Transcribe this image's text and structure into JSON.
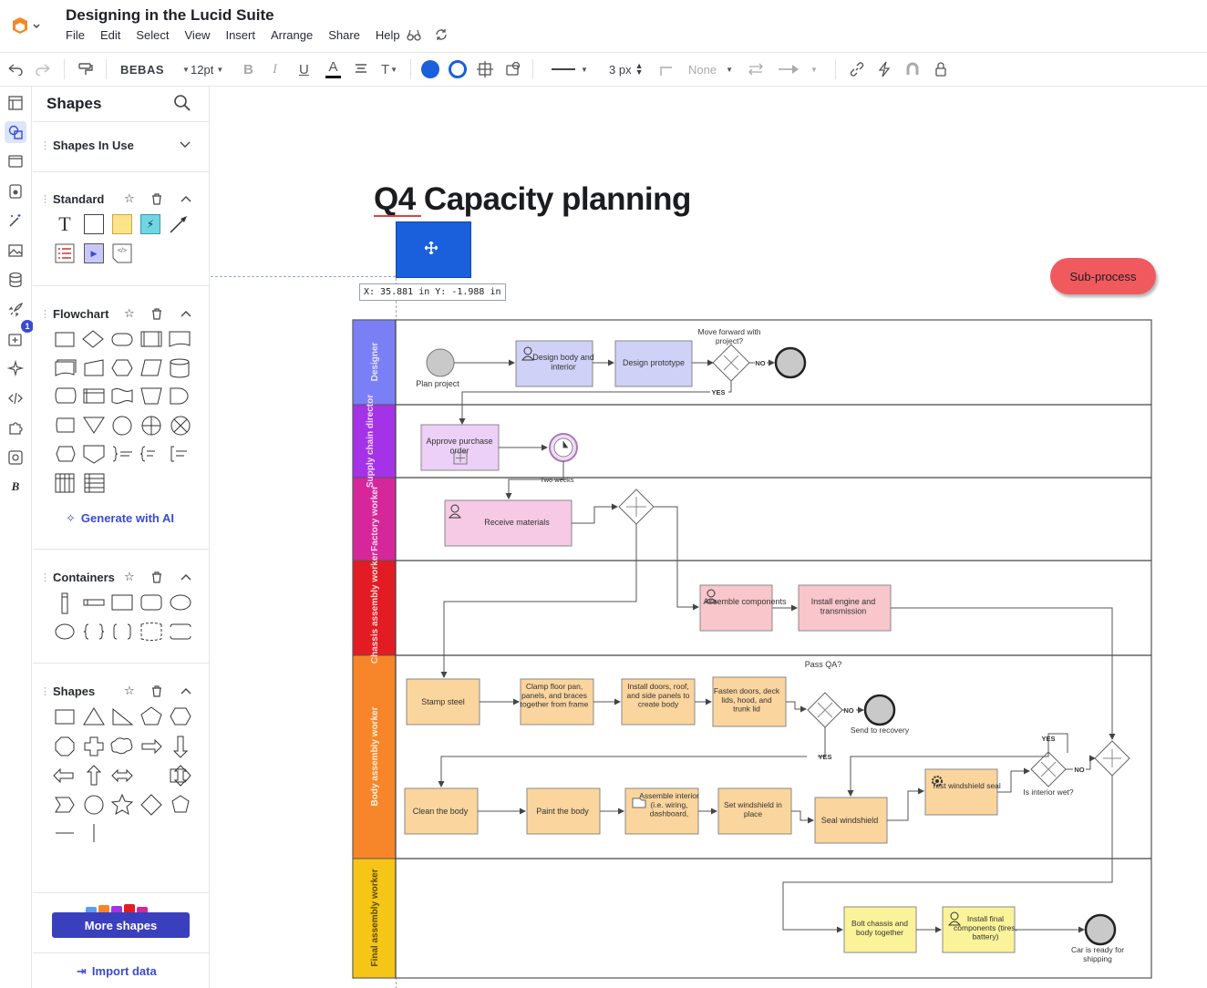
{
  "app": {
    "doc_title": "Designing in the Lucid Suite"
  },
  "menu": [
    "File",
    "Edit",
    "Select",
    "View",
    "Insert",
    "Arrange",
    "Share",
    "Help"
  ],
  "toolbar": {
    "font": "BEBAS",
    "font_size": "12pt",
    "line_width": "3 px",
    "arrow_none": "None"
  },
  "panel": {
    "title": "Shapes",
    "shapes_in_use": "Shapes In Use",
    "standard": "Standard",
    "flowchart": "Flowchart",
    "generate_ai": "Generate with AI",
    "containers": "Containers",
    "shapes": "Shapes",
    "more_shapes": "More shapes",
    "import_data": "Import data",
    "notification_count": "1"
  },
  "canvas": {
    "title": "Q4 Capacity planning",
    "coord_readout": "X: 35.881 in  Y: -1.988 in",
    "subprocess": "Sub-process"
  },
  "lanes": [
    {
      "label": "Designer",
      "color": "#7b7ff6"
    },
    {
      "label": "Supply chain director",
      "color": "#a433e8"
    },
    {
      "label": "Factory worker",
      "color": "#d6279a"
    },
    {
      "label": "Chassis assembly worker",
      "color": "#e31b23"
    },
    {
      "label": "Body assembly worker",
      "color": "#f7862b"
    },
    {
      "label": "Final assembly worker",
      "color": "#f5c518"
    }
  ],
  "nodes": {
    "plan_project": "Plan project",
    "design_body": "Design body and interior",
    "design_prototype": "Design prototype",
    "move_forward": "Move forward with project?",
    "no": "NO",
    "yes": "YES",
    "approve_po": "Approve purchase order",
    "two_weeks": "Two weeks",
    "receive_materials": "Receive materials",
    "assemble_components": "Assemble components",
    "install_engine": "Install engine and transmission",
    "pass_qa": "Pass QA?",
    "stamp_steel": "Stamp steel",
    "clamp_floor": "Clamp floor pan, panels, and braces together from frame",
    "install_doors": "Install doors, roof, and side panels to create body",
    "fasten_doors": "Fasten doors, deck lids, hood, and trunk lid",
    "send_recovery": "Send to recovery",
    "clean_body": "Clean the body",
    "paint_body": "Paint the body",
    "assemble_interior": "Assemble interior (i.e. wiring, dashboard,",
    "set_windshield": "Set windshield in place",
    "seal_windshield": "Seal windshield",
    "test_seal": "Test windshield seal",
    "interior_wet": "Is interior wet?",
    "bolt_chassis": "Bolt chassis and body together",
    "install_final": "Install final components (tires, battery)",
    "car_ready": "Car is ready for shipping"
  },
  "colors": {
    "accent": "#3a4bd1",
    "selection_blue": "#1a5fdb",
    "subprocess_red": "#f05a5e"
  }
}
